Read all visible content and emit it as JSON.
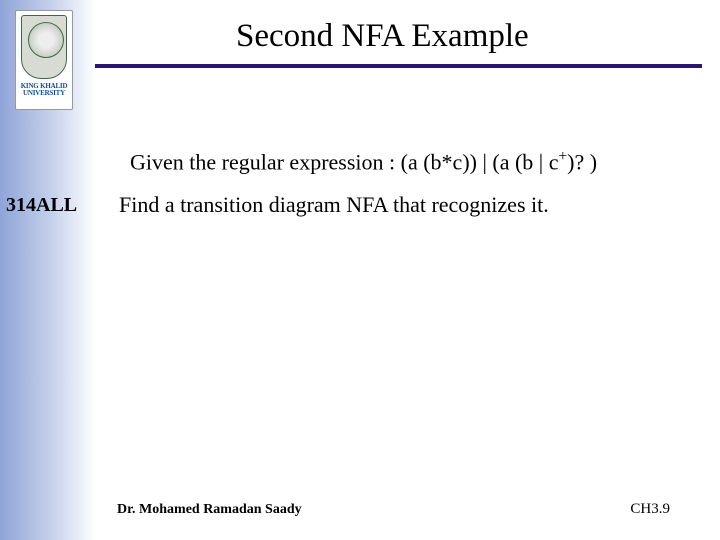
{
  "slide": {
    "title": "Second NFA Example",
    "course_code": "314ALL",
    "logo_text": "KING KHALID UNIVERSITY",
    "body": {
      "line1_prefix": "Given the regular expression :  (a (b*c)) | (a (b | c",
      "line1_sup": "+",
      "line1_suffix": ")? )",
      "line2": "Find a transition diagram NFA that recognizes it."
    },
    "footer": {
      "author": "Dr. Mohamed Ramadan Saady",
      "page": "CH3.9"
    }
  }
}
